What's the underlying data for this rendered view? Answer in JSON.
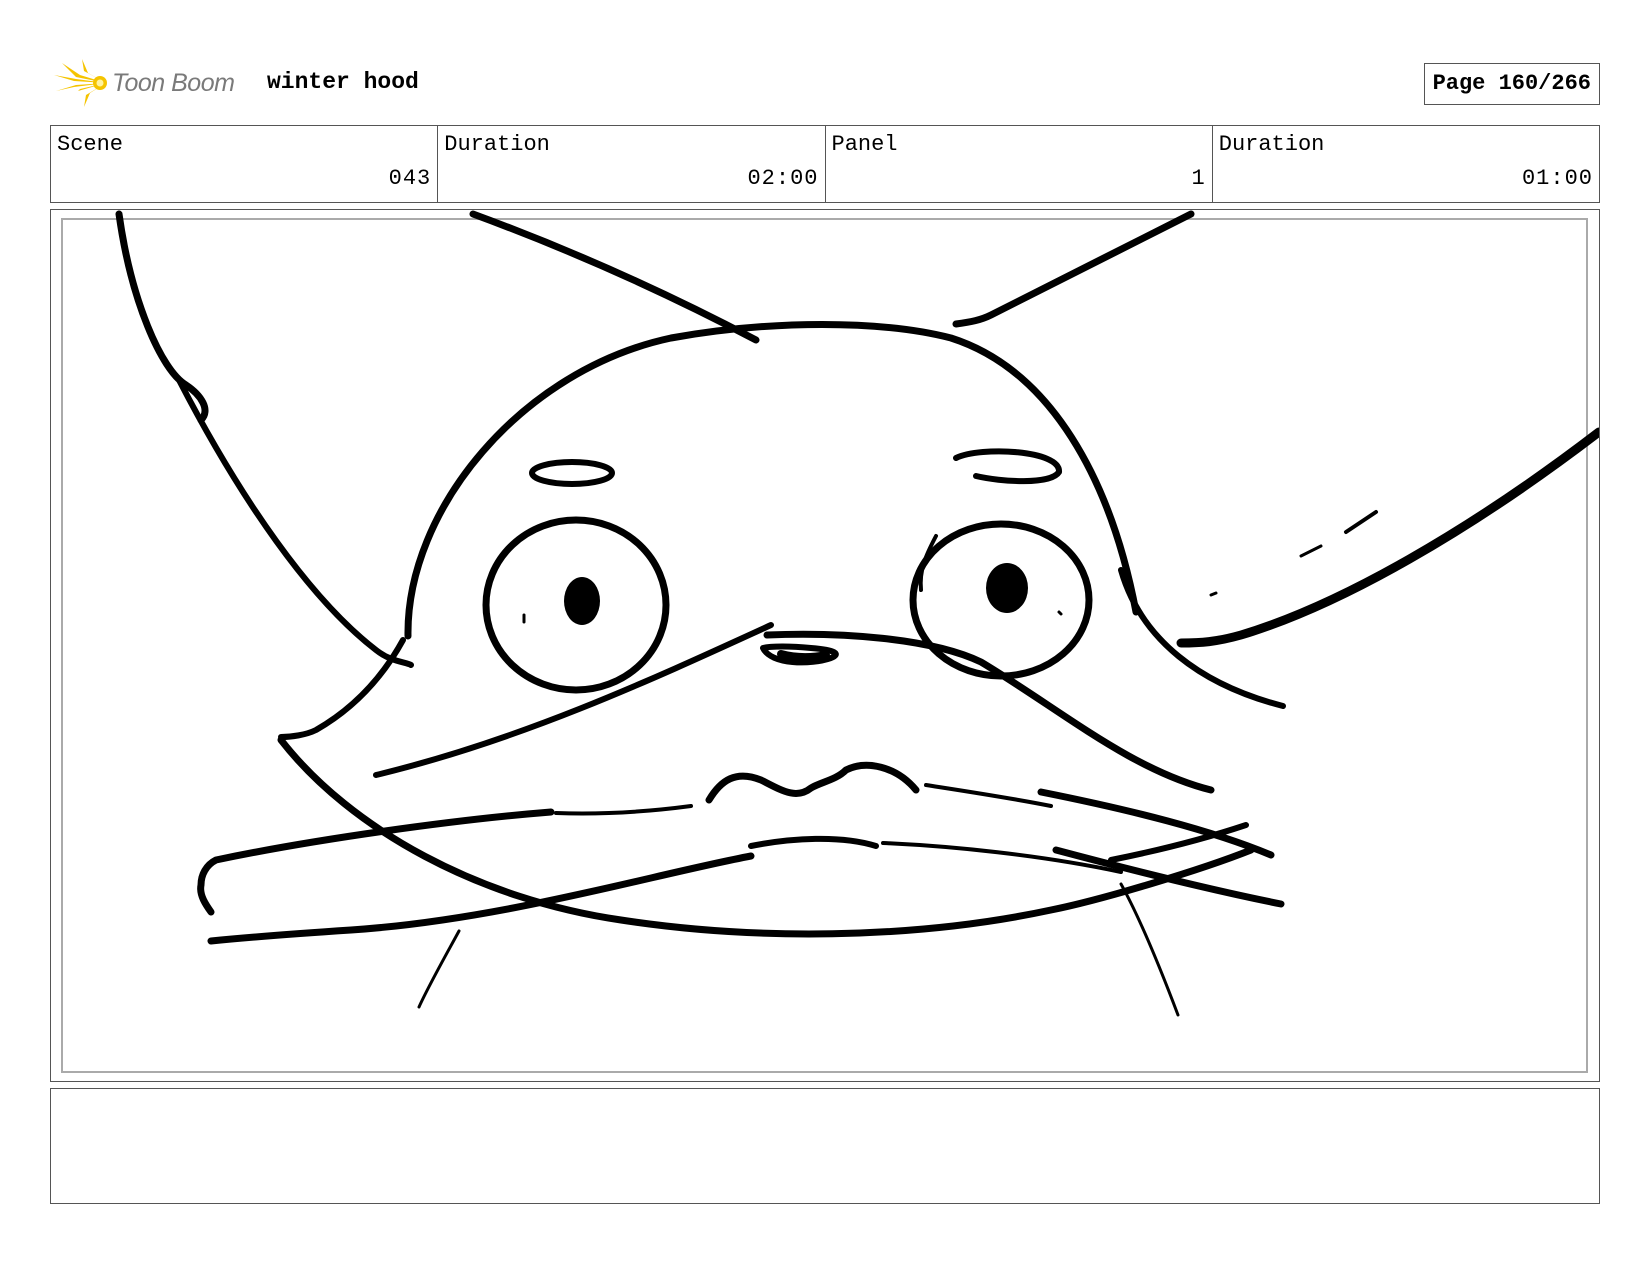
{
  "header": {
    "logo_text": "Toon Boom",
    "project_title": "winter hood",
    "page_label": "Page 160/266"
  },
  "info": [
    {
      "label": "Scene",
      "value": "043"
    },
    {
      "label": "Duration",
      "value": "02:00"
    },
    {
      "label": "Panel",
      "value": "1"
    },
    {
      "label": "Duration",
      "value": "01:00"
    }
  ],
  "colors": {
    "logo_star": "#f5c400",
    "logo_text": "#7a7a7a",
    "border": "#555555",
    "inner_border": "#aaaaaa"
  },
  "notes": ""
}
